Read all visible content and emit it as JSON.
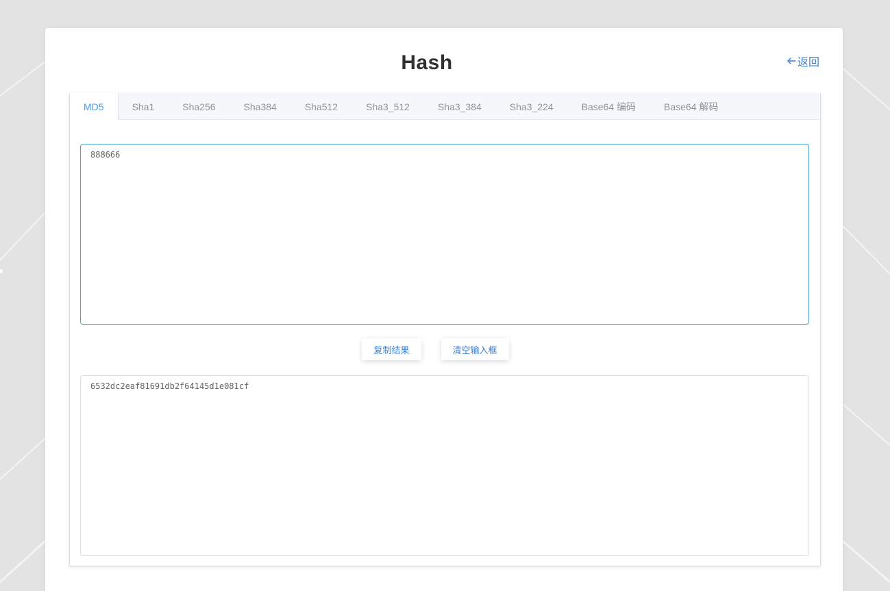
{
  "page": {
    "title": "Hash",
    "back_label": "返回"
  },
  "tabs": [
    {
      "label": "MD5",
      "active": true
    },
    {
      "label": "Sha1",
      "active": false
    },
    {
      "label": "Sha256",
      "active": false
    },
    {
      "label": "Sha384",
      "active": false
    },
    {
      "label": "Sha512",
      "active": false
    },
    {
      "label": "Sha3_512",
      "active": false
    },
    {
      "label": "Sha3_384",
      "active": false
    },
    {
      "label": "Sha3_224",
      "active": false
    },
    {
      "label": "Base64 编码",
      "active": false
    },
    {
      "label": "Base64 解码",
      "active": false
    }
  ],
  "input": {
    "value": "888666"
  },
  "buttons": {
    "copy_label": "复制结果",
    "clear_label": "清空输入框"
  },
  "output": {
    "value": "6532dc2eaf81691db2f64145d1e081cf"
  },
  "colors": {
    "accent": "#409eff",
    "link": "#3a7fd0",
    "background": "#e4e4e4",
    "card": "#ffffff"
  },
  "icons": {
    "back": "arrow-left-icon"
  }
}
